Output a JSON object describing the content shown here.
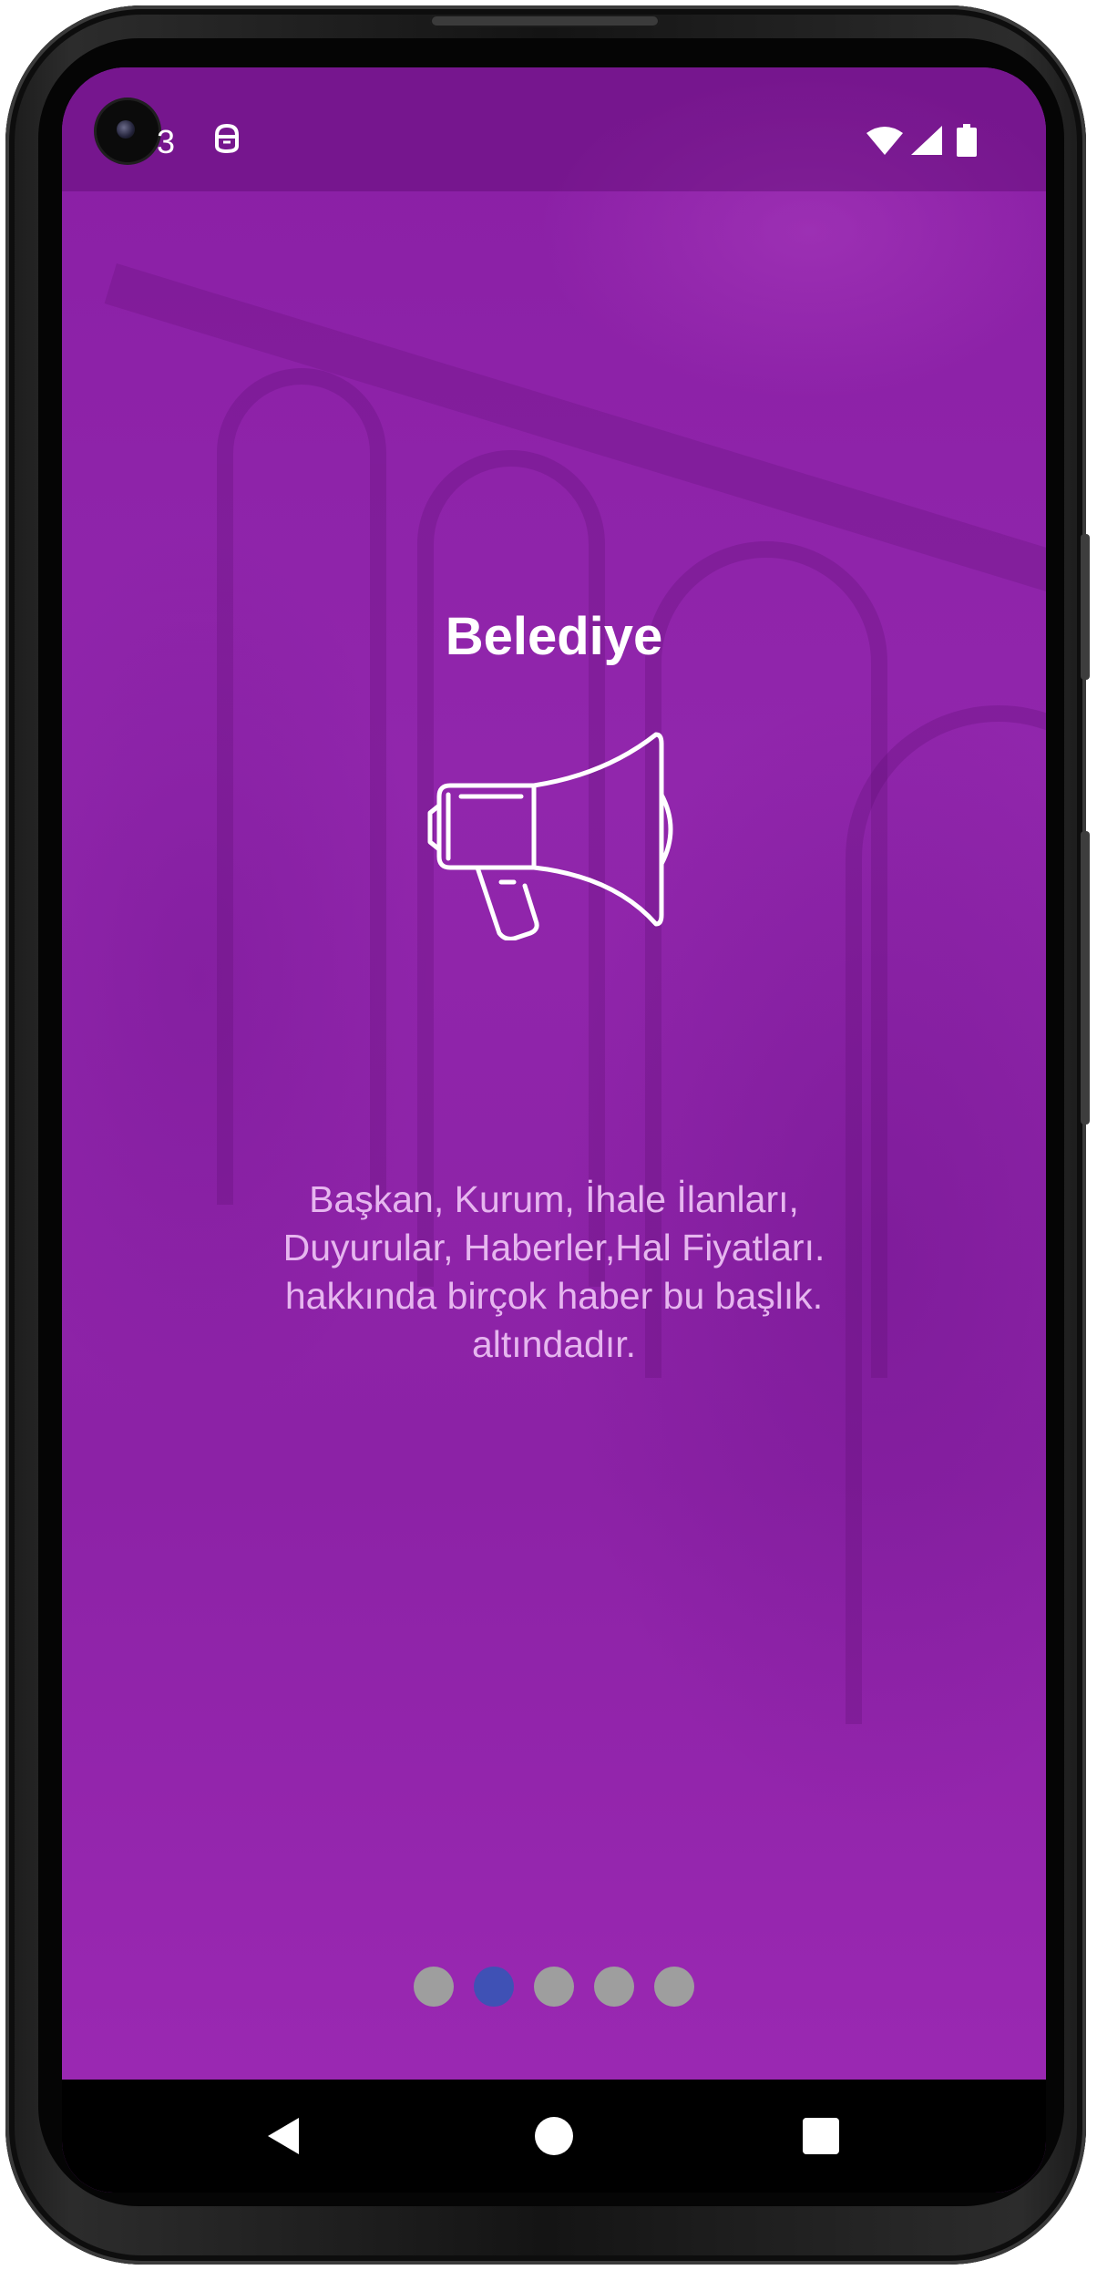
{
  "status_bar": {
    "time": "3",
    "icons": [
      "camera-hole",
      "assistant-icon",
      "wifi-icon",
      "cellular-signal-icon",
      "battery-icon"
    ]
  },
  "onboarding": {
    "title": "Belediye",
    "icon": "megaphone-icon",
    "description_lines": [
      "Başkan, Kurum, İhale İlanları,",
      "Duyurular, Haberler,Hal Fiyatları.",
      "hakkında birçok haber bu başlık.",
      "altındadır."
    ],
    "page_count": 5,
    "active_page_index": 1
  },
  "nav_bar": {
    "buttons": [
      "back-icon",
      "home-icon",
      "recents-icon"
    ]
  },
  "colors": {
    "background": "#8e24aa",
    "title_text": "#ffffff",
    "description_text": "#e6b6ef",
    "dot_inactive": "#9e9e9e",
    "dot_active": "#3f51b5",
    "nav_bar": "#000000"
  }
}
